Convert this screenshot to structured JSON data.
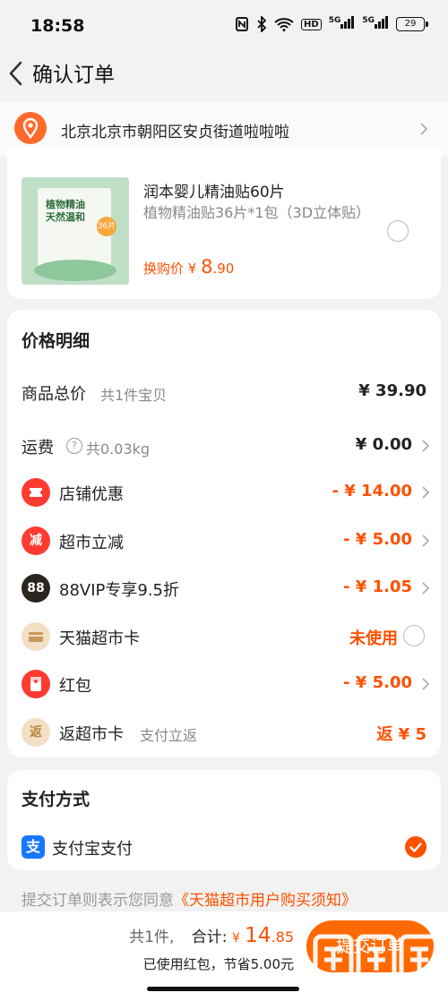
{
  "status_bar": {
    "time": "18:58",
    "icons": [
      "nfc-icon",
      "bluetooth-icon",
      "wifi-icon",
      "hd-icon",
      "signal-5g-icon",
      "signal-5g-icon"
    ],
    "hd_label": "HD",
    "signal_label": "5G",
    "battery": "29"
  },
  "header": {
    "title": "确认订单"
  },
  "address": {
    "text": "北京北京市朝阳区安贞街道啦啦啦"
  },
  "product": {
    "thumbnail_text": "植物精油\n天然温和",
    "thumbnail_badge": "36片",
    "title": "润本婴儿精油贴60片",
    "spec": "植物精油贴36片*1包（3D立体贴）",
    "price_label": "换购价",
    "currency": "¥",
    "price_int": "8",
    "price_dec": ".90"
  },
  "price_detail": {
    "title": "价格明细",
    "subtotal": {
      "label": "商品总价",
      "sub": "共1件宝贝",
      "value": "¥ 39.90"
    },
    "shipping": {
      "label": "运费",
      "help": "?",
      "sub": "共0.03kg",
      "value": "¥ 0.00"
    },
    "discounts": [
      {
        "icon": "ticket-icon",
        "icon_text": "",
        "color": "#ff3b30",
        "label": "店铺优惠",
        "sub": "",
        "value": "- ¥ 14.00"
      },
      {
        "icon": "reduce-icon",
        "icon_text": "减",
        "color": "#ff3b30",
        "label": "超市立减",
        "sub": "",
        "value": "- ¥ 5.00"
      },
      {
        "icon": "vip-88-icon",
        "icon_text": "88",
        "color": "#2b2520",
        "label": "88VIP专享9.5折",
        "sub": "",
        "value": "- ¥ 1.05"
      },
      {
        "icon": "card-icon",
        "icon_text": "",
        "color": "#f3dfc6",
        "label": "天猫超市卡",
        "sub": "",
        "value": "未使用"
      },
      {
        "icon": "red-packet-icon",
        "icon_text": "",
        "color": "#ff3b30",
        "label": "红包",
        "sub": "",
        "value": "- ¥ 5.00"
      },
      {
        "icon": "refund-icon",
        "icon_text": "返",
        "color": "#f3dfc6",
        "label": "返超市卡",
        "sub": "支付立返",
        "value": "返 ¥ 5"
      }
    ]
  },
  "payment": {
    "title": "支付方式",
    "icon_text": "支",
    "method": "支付宝支付"
  },
  "agreement": {
    "prefix": "提交订单则表示您同意",
    "link": "《天猫超市用户购买须知》"
  },
  "bottom_bar": {
    "count": "共1件,",
    "total_label": "合计:",
    "currency": "¥",
    "total_int": "14",
    "total_dec": ".85",
    "discount_note": "已使用红包，节省5.00元",
    "submit_label": "提交订单",
    "watermark": "zhizhizhi.com"
  },
  "colors": {
    "accent": "#ff5000",
    "background": "#f2f2f2",
    "alipay": "#1677ff"
  }
}
